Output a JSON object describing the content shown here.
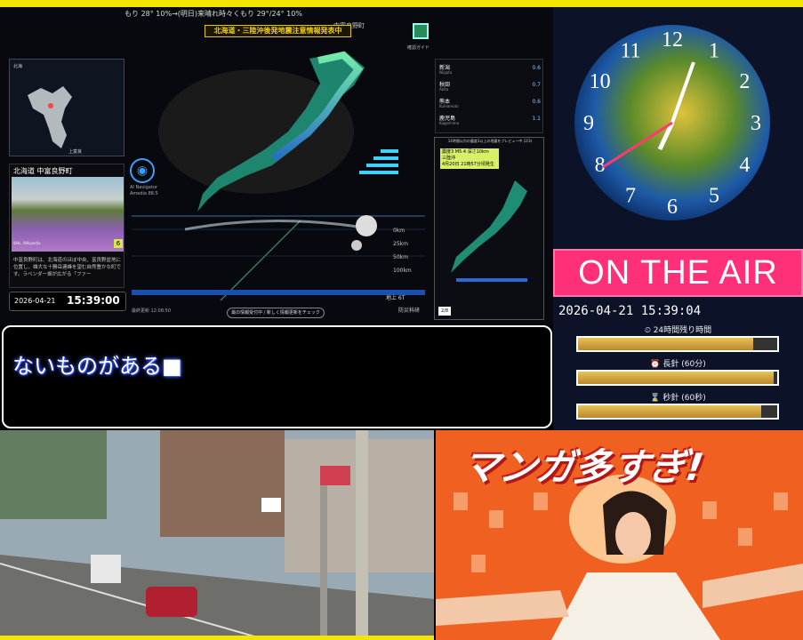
{
  "quake": {
    "ticker": "もり 28° 10%→(明日)来晴れ時々くもり 29°/24° 10%",
    "ticker_location": "中富良野町",
    "alert": "北海道・三陸沖後発地震注意情報発表中",
    "guide_label": "確認ガイド",
    "minimap_region": "北海",
    "minimap_city": "上富良",
    "location_title": "北海道 中富良野町",
    "location_credit": "Wiki, Wikipedia",
    "location_intensity": "6",
    "location_desc": "中富良野町は、北海道のほぼ中央、富良野盆地に位置し、雄大な十勝岳連峰を望む自然豊かな町です。ラベンダー畑が広がる「ファー",
    "date": "2026-04-21",
    "time": "15:39:00",
    "ai_name": "AI Navigator",
    "ai_version": "Amedia 88.5",
    "map_label": "大宮町",
    "depths": [
      "0km",
      "25km",
      "50km",
      "100km"
    ],
    "update_info": "最終更新 12:08:50",
    "check_button": "最の情報受付中 / 新しく情報更新をチェック",
    "magnitude_label": "地上 6T",
    "org_label": "防災科研",
    "stations": [
      {
        "name": "新潟",
        "sub": "Niigata",
        "value": "0.6"
      },
      {
        "name": "秋田",
        "sub": "Akita",
        "value": "0.7"
      },
      {
        "name": "熊本",
        "sub": "Kumamoto",
        "value": "0.6"
      },
      {
        "name": "鹿児島",
        "sub": "Kagoshima",
        "value": "1.1"
      }
    ],
    "preview_title": "14時間以内の震度3以上の地震をプレビュー中 (2/3)",
    "preview_intensity": "震度3 M5.4 深さ10km",
    "preview_region": "三陸沖",
    "preview_time": "4月20日 21時57分頃発生",
    "preview_badge": "2/8"
  },
  "subtitle": {
    "text": "ないものがある■"
  },
  "clock_panel": {
    "numbers": [
      "12",
      "1",
      "2",
      "3",
      "4",
      "5",
      "6",
      "7",
      "8",
      "9",
      "10",
      "11"
    ],
    "on_air": "ON THE AIR",
    "datetime": "2026-04-21 15:39:04",
    "bars": [
      {
        "label": "⏲ 24時間残り時間",
        "value": 0.88
      },
      {
        "label": "⏰ 長針 (60分)",
        "value": 0.98
      },
      {
        "label": "⌛ 秒針 (60秒)",
        "value": 0.92
      }
    ]
  },
  "manga": {
    "title": "マンガ多すぎ!"
  }
}
